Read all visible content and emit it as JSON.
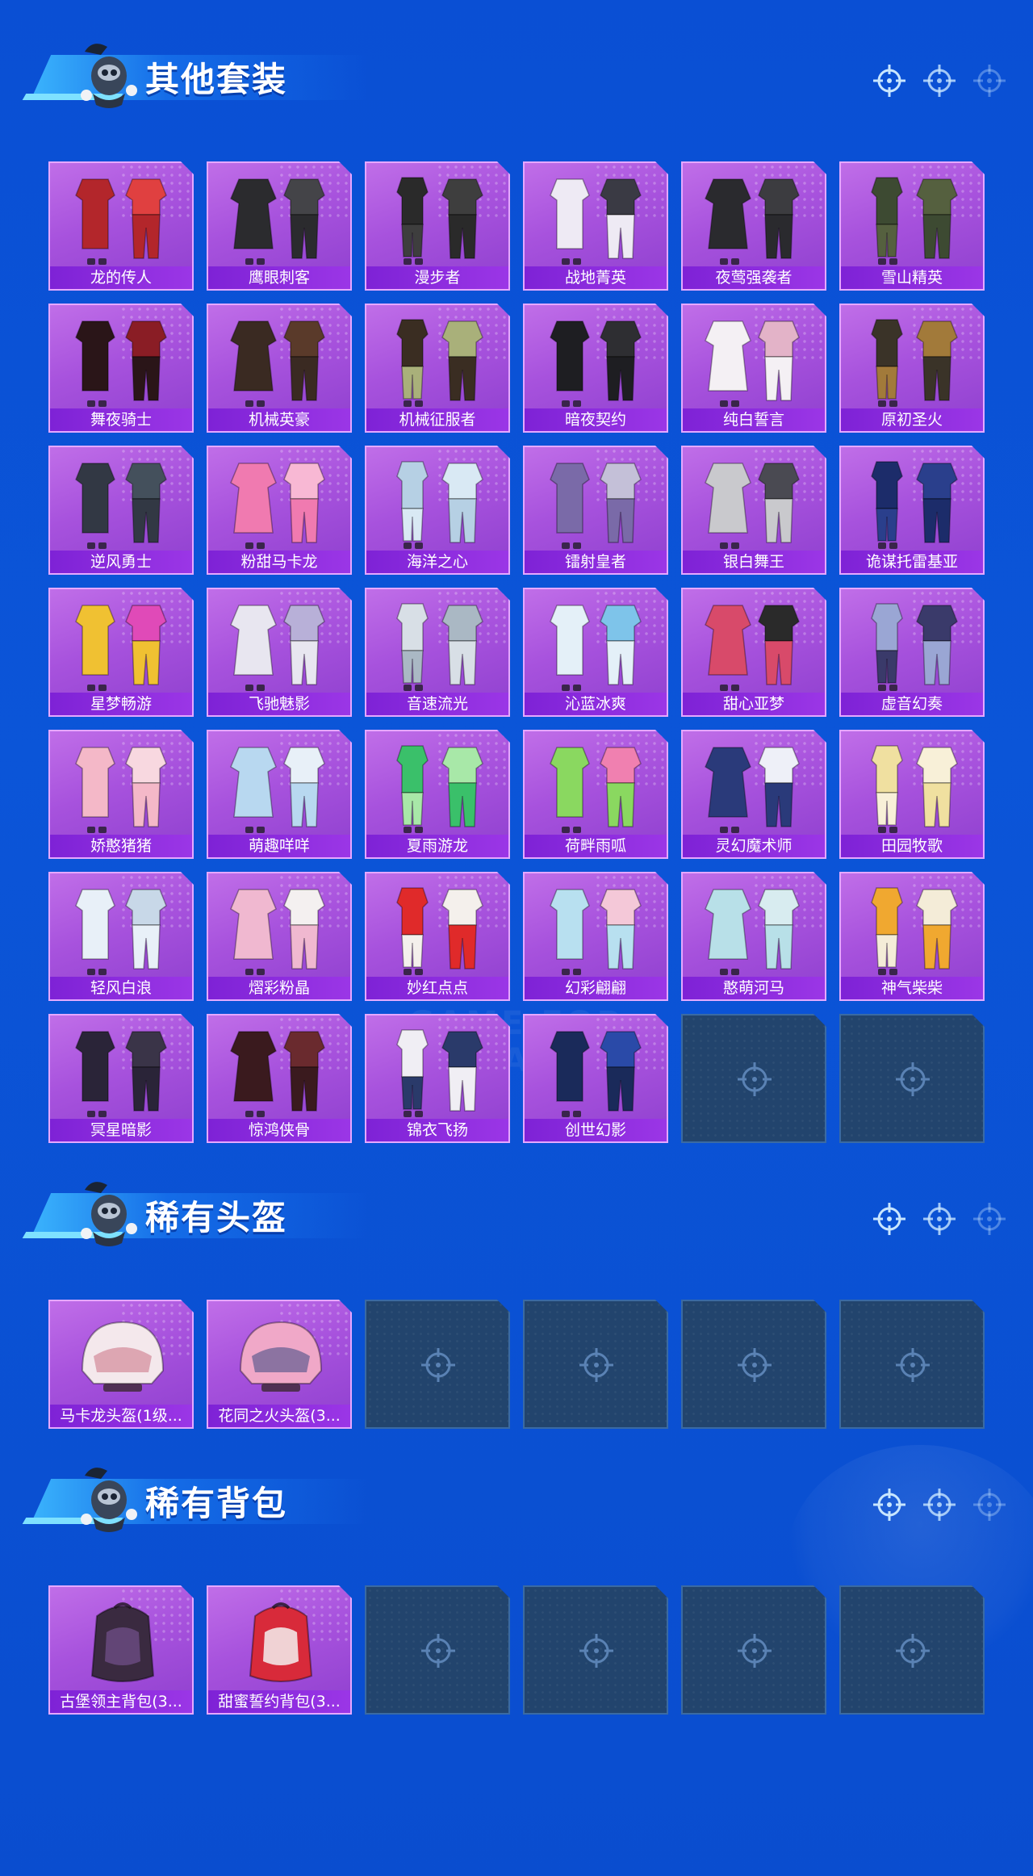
{
  "sections": [
    {
      "id": "other-sets",
      "title": "其他套装",
      "items": [
        {
          "name": "龙的传人",
          "palette": [
            "#b3262b",
            "#e04040"
          ]
        },
        {
          "name": "鹰眼刺客",
          "palette": [
            "#2b2b2e",
            "#444448"
          ]
        },
        {
          "name": "漫步者",
          "palette": [
            "#2a2a2a",
            "#3e3e3e"
          ]
        },
        {
          "name": "战地菁英",
          "palette": [
            "#eeeaf4",
            "#3a3a44"
          ]
        },
        {
          "name": "夜莺强袭者",
          "palette": [
            "#2a2a2e",
            "#3c3c40"
          ]
        },
        {
          "name": "雪山精英",
          "palette": [
            "#3d4a32",
            "#55603f"
          ]
        },
        {
          "name": "舞夜骑士",
          "palette": [
            "#2a1518",
            "#8a1d25"
          ]
        },
        {
          "name": "机械英豪",
          "palette": [
            "#3a2a22",
            "#5a3a2a"
          ]
        },
        {
          "name": "机械征服者",
          "palette": [
            "#3a2d22",
            "#a9b07a"
          ]
        },
        {
          "name": "暗夜契约",
          "palette": [
            "#1e1e22",
            "#2e2e32"
          ]
        },
        {
          "name": "纯白誓言",
          "palette": [
            "#f4f0f4",
            "#e3b3c8"
          ]
        },
        {
          "name": "原初圣火",
          "palette": [
            "#3a3328",
            "#a27a3a"
          ]
        },
        {
          "name": "逆风勇士",
          "palette": [
            "#323844",
            "#44505c"
          ]
        },
        {
          "name": "粉甜马卡龙",
          "palette": [
            "#f07ab0",
            "#f8b8d4"
          ]
        },
        {
          "name": "海洋之心",
          "palette": [
            "#b6d0e4",
            "#d9e9f4"
          ]
        },
        {
          "name": "镭射皇者",
          "palette": [
            "#7a6aa8",
            "#c4c0d8"
          ]
        },
        {
          "name": "银白舞王",
          "palette": [
            "#c9c9cd",
            "#4a4a52"
          ]
        },
        {
          "name": "诡谋托雷基亚",
          "palette": [
            "#1c2c6a",
            "#2a3f8c"
          ]
        },
        {
          "name": "星梦畅游",
          "palette": [
            "#f0c132",
            "#e04ab8"
          ]
        },
        {
          "name": "飞驰魅影",
          "palette": [
            "#e8e6f0",
            "#b8b0d8"
          ]
        },
        {
          "name": "音速流光",
          "palette": [
            "#d8dfe6",
            "#aab8c4"
          ]
        },
        {
          "name": "沁蓝冰爽",
          "palette": [
            "#e4f0f8",
            "#7ec4ea"
          ]
        },
        {
          "name": "甜心亚梦",
          "palette": [
            "#d84a6a",
            "#2a2a2a"
          ]
        },
        {
          "name": "虚音幻奏",
          "palette": [
            "#9aa6d4",
            "#3a3a6a"
          ]
        },
        {
          "name": "娇憨猪猪",
          "palette": [
            "#f4b8c8",
            "#f8d8e0"
          ]
        },
        {
          "name": "萌趣咩咩",
          "palette": [
            "#b8d8f0",
            "#e8f0f8"
          ]
        },
        {
          "name": "夏雨游龙",
          "palette": [
            "#3ac06a",
            "#a8e8a8"
          ]
        },
        {
          "name": "荷畔雨呱",
          "palette": [
            "#8ad860",
            "#f080b0"
          ]
        },
        {
          "name": "灵幻魔术师",
          "palette": [
            "#2a3a7a",
            "#eef0f8"
          ]
        },
        {
          "name": "田园牧歌",
          "palette": [
            "#f0e0a0",
            "#f8f0d8"
          ]
        },
        {
          "name": "轻风白浪",
          "palette": [
            "#e8f0f8",
            "#c8d8e8"
          ]
        },
        {
          "name": "熠彩粉晶",
          "palette": [
            "#f0b8d0",
            "#f4f0f0"
          ]
        },
        {
          "name": "妙红点点",
          "palette": [
            "#e02a2a",
            "#f4f0ec"
          ]
        },
        {
          "name": "幻彩翩翩",
          "palette": [
            "#b8e0f0",
            "#f4c8d8"
          ]
        },
        {
          "name": "憨萌河马",
          "palette": [
            "#b8e0e8",
            "#d8ecf0"
          ]
        },
        {
          "name": "神气柴柴",
          "palette": [
            "#f0a830",
            "#f4ecd8"
          ]
        },
        {
          "name": "冥星暗影",
          "palette": [
            "#2a2438",
            "#3a3448"
          ]
        },
        {
          "name": "惊鸿侠骨",
          "palette": [
            "#3a1a1e",
            "#6a2a2e"
          ]
        },
        {
          "name": "锦衣飞扬",
          "palette": [
            "#f0eef4",
            "#2a3a6a"
          ]
        },
        {
          "name": "创世幻影",
          "palette": [
            "#1a2a5a",
            "#2a4aa8"
          ]
        },
        {
          "empty": true
        },
        {
          "empty": true
        }
      ]
    },
    {
      "id": "rare-helmets",
      "title": "稀有头盔",
      "items": [
        {
          "name": "马卡龙头盔(1级...",
          "palette": [
            "#f4e8ec",
            "#d89aa8"
          ]
        },
        {
          "name": "花同之火头盔(3...",
          "palette": [
            "#f0a8c8",
            "#7a6a9a"
          ]
        },
        {
          "empty": true
        },
        {
          "empty": true
        },
        {
          "empty": true
        },
        {
          "empty": true
        }
      ]
    },
    {
      "id": "rare-backpacks",
      "title": "稀有背包",
      "items": [
        {
          "name": "古堡领主背包(3...",
          "palette": [
            "#3a2a40",
            "#6a4a80"
          ]
        },
        {
          "name": "甜蜜誓约背包(3...",
          "palette": [
            "#d82a3a",
            "#f4f0f0"
          ]
        },
        {
          "empty": true
        },
        {
          "empty": true
        },
        {
          "empty": true
        },
        {
          "empty": true
        }
      ]
    }
  ],
  "watermark": "GAME FOR PEACE"
}
